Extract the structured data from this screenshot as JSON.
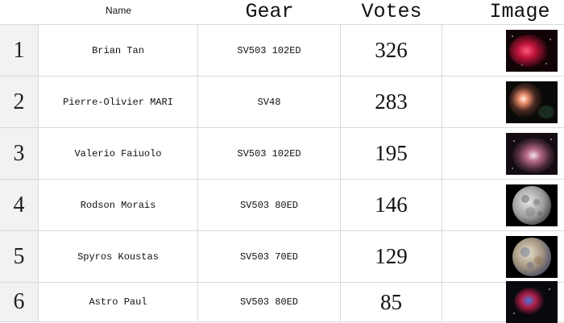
{
  "header": {
    "name": "Name",
    "gear": "Gear",
    "votes": "Votes",
    "image": "Image"
  },
  "rows": [
    {
      "rank": "1",
      "name": "Brian Tan",
      "gear": "SV503 102ED",
      "votes": "326",
      "image": "red-nebula-photo"
    },
    {
      "rank": "2",
      "name": "Pierre-Olivier MARI",
      "gear": "SV48",
      "votes": "283",
      "image": "orion-nebula-photo"
    },
    {
      "rank": "3",
      "name": "Valerio Faiuolo",
      "gear": "SV503 102ED",
      "votes": "195",
      "image": "orion-nebula-wide-photo"
    },
    {
      "rank": "4",
      "name": "Rodson Morais",
      "gear": "SV503 80ED",
      "votes": "146",
      "image": "gray-moon-photo"
    },
    {
      "rank": "5",
      "name": "Spyros Koustas",
      "gear": "SV503 70ED",
      "votes": "129",
      "image": "color-moon-photo"
    },
    {
      "rank": "6",
      "name": "Astro Paul",
      "gear": "SV503 80ED",
      "votes": "85",
      "image": "blue-red-nebula-photo"
    }
  ]
}
